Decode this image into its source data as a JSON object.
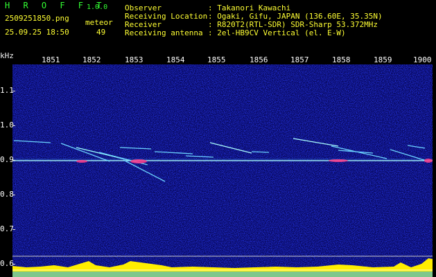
{
  "app": {
    "name": "H R O F F T",
    "version": "1.0.0"
  },
  "file": {
    "name": "2509251850.png",
    "timestamp": "25.09.25 18:50"
  },
  "meteor": {
    "label": "meteor",
    "count": "49"
  },
  "station": [
    {
      "label": "Observer",
      "value": ": Takanori Kawachi"
    },
    {
      "label": "Receiving Location",
      "value": ": Ogaki, Gifu, JAPAN (136.60E, 35.35N)"
    },
    {
      "label": "Receiver",
      "value": ": R820T2(RTL-SDR) SDR-Sharp 53.372MHz"
    },
    {
      "label": "Receiving antenna",
      "value": ": 2el-HB9CV Vertical (el. E-W)"
    }
  ],
  "axis": {
    "unit": "kHz",
    "time_ticks": [
      "1851",
      "1852",
      "1853",
      "1854",
      "1855",
      "1856",
      "1857",
      "1858",
      "1859",
      "1900"
    ],
    "freq_ticks": [
      "1.1",
      "1.0",
      "0.9",
      "0.8",
      "0.7",
      "0.6"
    ]
  },
  "colors": {
    "text": "#f2f2f2",
    "brand": "#ffff33",
    "accent": "#33ff33",
    "background": "#000000",
    "noise": "#0a0a6e",
    "carrier": "#aaffff",
    "level": "#ffee00"
  }
}
